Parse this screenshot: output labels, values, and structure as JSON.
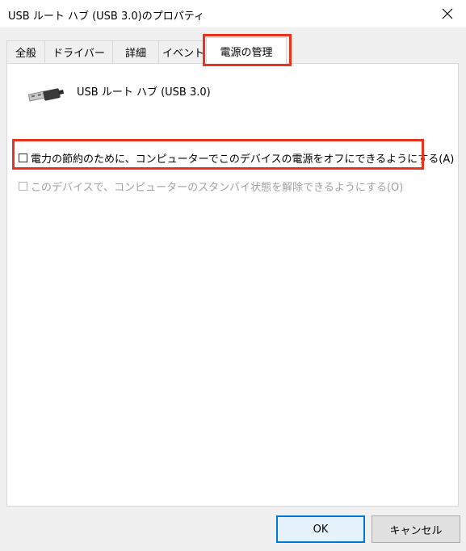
{
  "window": {
    "title": "USB ルート ハブ (USB 3.0)のプロパティ"
  },
  "tabs": [
    {
      "label": "全般"
    },
    {
      "label": "ドライバー"
    },
    {
      "label": "詳細"
    },
    {
      "label": "イベント"
    },
    {
      "label": "電源の管理",
      "selected": true
    }
  ],
  "device": {
    "name": "USB ルート ハブ (USB 3.0)",
    "icon": "usb-plug-icon"
  },
  "power_options": [
    {
      "label": "電力の節約のために、コンピューターでこのデバイスの電源をオフにできるようにする(A)",
      "checked": false,
      "enabled": true
    },
    {
      "label": "このデバイスで、コンピューターのスタンバイ状態を解除できるようにする(O)",
      "checked": false,
      "enabled": false
    }
  ],
  "buttons": {
    "ok": "OK",
    "cancel": "キャンセル"
  },
  "colors": {
    "highlight": "#e8341c",
    "accent": "#0078d7",
    "disabled_text": "#a0a0a0"
  }
}
